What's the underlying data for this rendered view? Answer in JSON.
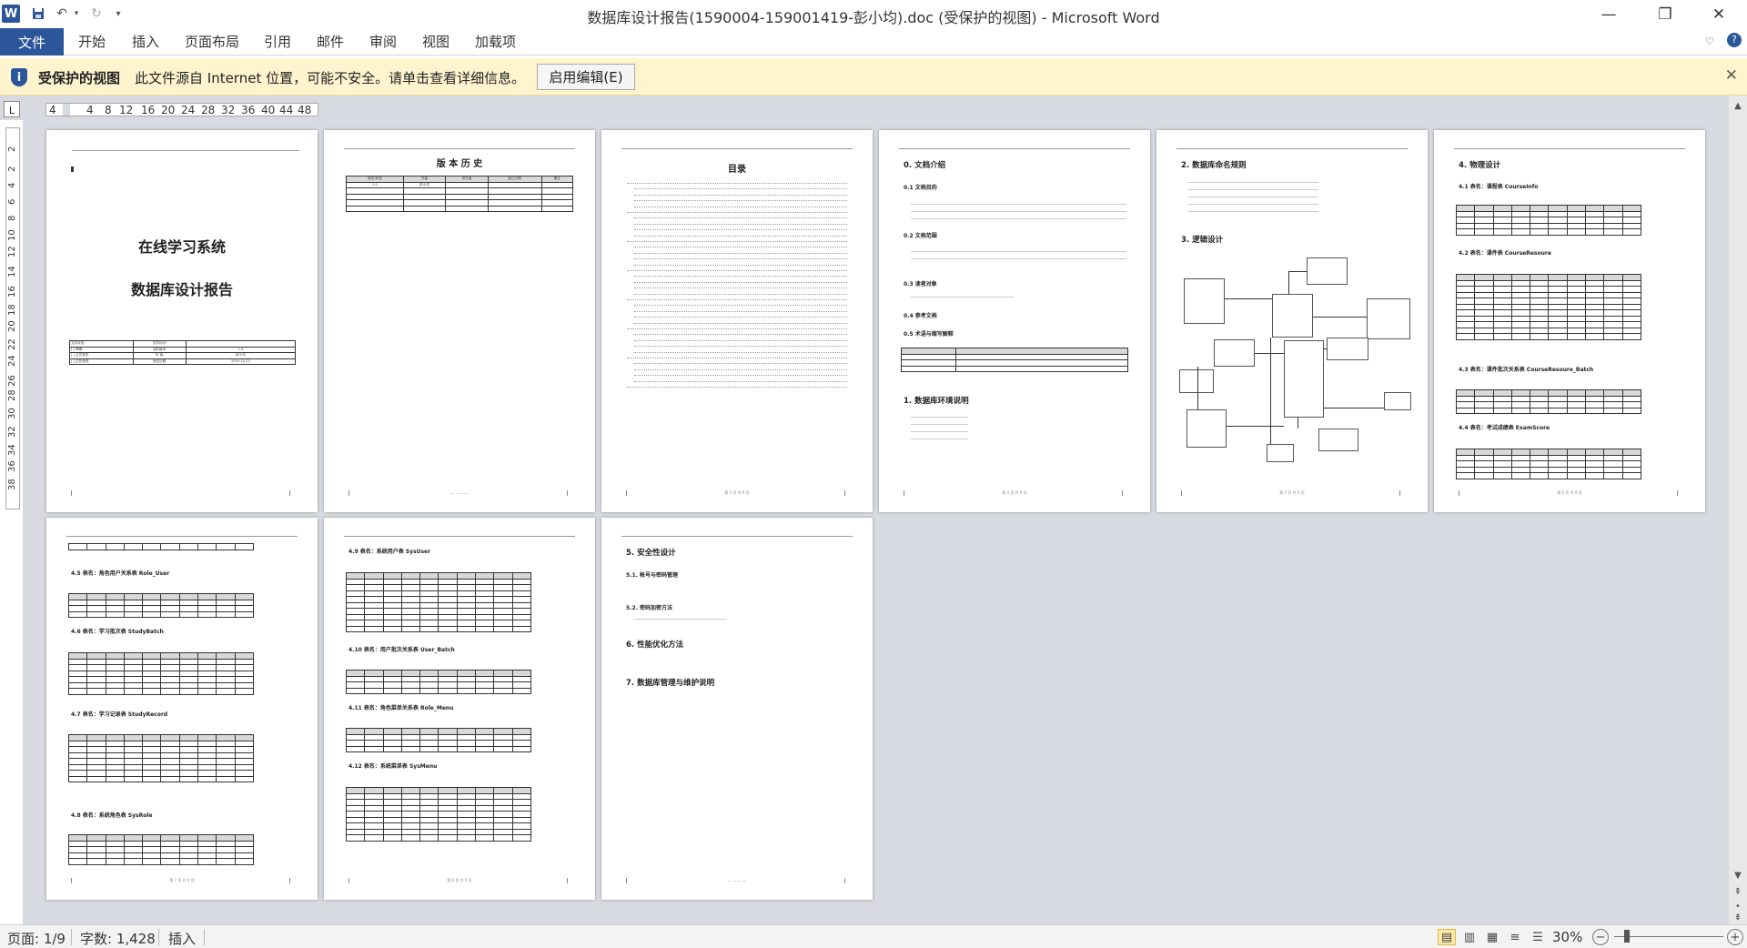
{
  "window": {
    "title": "数据库设计报告(1590004-159001419-彭小均).doc (受保护的视图)  -  Microsoft Word"
  },
  "qat": {
    "app_icon": "W",
    "save_icon": "save-icon",
    "undo_icon": "undo-icon",
    "redo_icon": "redo-icon",
    "customize_icon": "customize-icon"
  },
  "ribbon": {
    "file": "文件",
    "tabs": [
      "开始",
      "插入",
      "页面布局",
      "引用",
      "邮件",
      "审阅",
      "视图",
      "加载项"
    ]
  },
  "protected": {
    "label": "受保护的视图",
    "message": "此文件源自 Internet 位置，可能不安全。请单击查看详细信息。",
    "button": "启用编辑(E)"
  },
  "ruler": {
    "h": [
      "4",
      "4",
      "8",
      "12",
      "16",
      "20",
      "24",
      "28",
      "32",
      "36",
      "40",
      "44",
      "48"
    ],
    "v": [
      "2",
      "2",
      "4",
      "6",
      "8",
      "10",
      "12",
      "14",
      "16",
      "18",
      "20",
      "22",
      "24",
      "26",
      "28",
      "30",
      "32",
      "34",
      "36",
      "38",
      "40",
      "42",
      "44",
      "46",
      "48"
    ]
  },
  "pages": {
    "p1": {
      "title1": "在线学习系统",
      "title2": "数据库设计报告",
      "info": [
        [
          "文件状态:",
          "文件标识:",
          ""
        ],
        [
          "[ ] 草稿",
          "当前版本:",
          "1.0"
        ],
        [
          "[ ] 正式发布",
          "作    者:",
          "彭小均"
        ],
        [
          "[ ] 正在修改",
          "完成日期:",
          "2019-10-22"
        ]
      ]
    },
    "p2": {
      "title": "版 本 历 史",
      "headers": [
        "版本/状态",
        "作者",
        "参与者",
        "起止日期",
        "备注"
      ],
      "row1": [
        "1.0",
        "彭小均",
        "",
        "",
        ""
      ]
    },
    "p3": {
      "title": "目录",
      "footer": "第 3 页 共 9 页"
    },
    "p4": {
      "h0": "0.  文档介绍",
      "h01": "0.1  文档目的",
      "h02": "0.2  文档范围",
      "h03": "0.3  读者对象",
      "h04": "0.4  参考文档",
      "h05": "0.5  术语与缩写解释",
      "h1": "1. 数据库环境说明",
      "footer": "第 4 页 共 9 页"
    },
    "p5": {
      "h2": "2. 数据库命名规则",
      "h3": "3. 逻辑设计",
      "footer": "第 5 页 共 9 页"
    },
    "p6": {
      "h4": "4.  物理设计",
      "t41": "4.1 表名：课程表 CourseInfo",
      "t42": "4.2 表名：课件表 CourseResoure",
      "t43": "4.3 表名：课件批次关系表 CourseResoure_Batch",
      "t44": "4.4 表名：考试成绩表 ExamScore",
      "footer": "第 6 页 共 9 页"
    },
    "p7": {
      "t45": "4.5 表名：角色用户关系表 Role_User",
      "t46": "4.6 表名：学习批次表 StudyBatch",
      "t47": "4.7 表名：学习记录表 StudyRecord",
      "t48": "4.8 表名：系统角色表 SysRole",
      "footer": "第 7 页 共 9 页"
    },
    "p8": {
      "t49": "4.9 表名：系统用户表 SysUser",
      "t410": "4.10 表名：用户批次关系表 User_Batch",
      "t411": "4.11 表名：角色菜单关系表 Role_Menu",
      "t412": "4.12 表名：系统菜单表 SysMenu",
      "footer": "第 8 页 共 9 页"
    },
    "p9": {
      "h5": "5.  安全性设计",
      "h51": "5.1.  帐号与密码管理",
      "h52": "5.2.  密码加密方法",
      "h6": "6.  性能优化方法",
      "h7": "7.  数据库管理与维护说明"
    }
  },
  "status": {
    "page": "页面: 1/9",
    "words": "字数: 1,428",
    "mode": "插入",
    "zoom": "30%"
  }
}
